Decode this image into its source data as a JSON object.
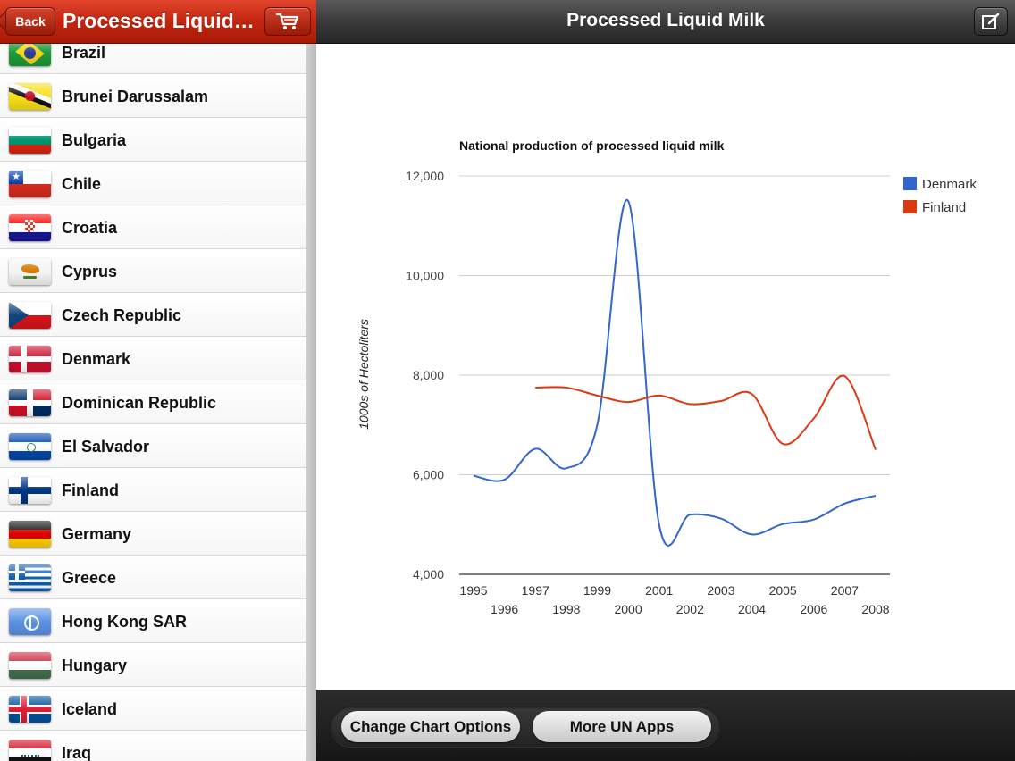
{
  "left_nav": {
    "back_label": "Back",
    "title": "Processed Liquid Milk",
    "cart_icon": "cart-icon"
  },
  "countries": [
    {
      "name": "Brazil",
      "flag": "flag-brazil-icon"
    },
    {
      "name": "Brunei Darussalam",
      "flag": "flag-brunei-icon"
    },
    {
      "name": "Bulgaria",
      "flag": "flag-bulgaria-icon"
    },
    {
      "name": "Chile",
      "flag": "flag-chile-icon"
    },
    {
      "name": "Croatia",
      "flag": "flag-croatia-icon"
    },
    {
      "name": "Cyprus",
      "flag": "flag-cyprus-icon"
    },
    {
      "name": "Czech Republic",
      "flag": "flag-czech-icon"
    },
    {
      "name": "Denmark",
      "flag": "flag-denmark-icon"
    },
    {
      "name": "Dominican Republic",
      "flag": "flag-dominican-icon"
    },
    {
      "name": "El Salvador",
      "flag": "flag-el-salvador-icon"
    },
    {
      "name": "Finland",
      "flag": "flag-finland-icon"
    },
    {
      "name": "Germany",
      "flag": "flag-germany-icon"
    },
    {
      "name": "Greece",
      "flag": "flag-greece-icon"
    },
    {
      "name": "Hong Kong SAR",
      "flag": "flag-un-icon"
    },
    {
      "name": "Hungary",
      "flag": "flag-hungary-icon"
    },
    {
      "name": "Iceland",
      "flag": "flag-iceland-icon"
    },
    {
      "name": "Iraq",
      "flag": "flag-iraq-icon"
    }
  ],
  "right_nav": {
    "title": "Processed Liquid Milk",
    "edit_icon": "compose-icon"
  },
  "bottom_toolbar": {
    "change_chart_label": "Change Chart Options",
    "more_apps_label": "More UN Apps"
  },
  "colors": {
    "denmark": "#3366cc",
    "finland": "#dc3912",
    "nav_red": "#c4250f",
    "nav_dark": "#3a3a3a"
  },
  "chart_data": {
    "type": "line",
    "title": "National production of processed liquid milk",
    "xlabel": "",
    "ylabel": "1000s of Hectoliters",
    "x": [
      1995,
      1996,
      1997,
      1998,
      1999,
      2000,
      2001,
      2002,
      2003,
      2004,
      2005,
      2006,
      2007,
      2008
    ],
    "ylim": [
      4000,
      12000
    ],
    "yticks": [
      "4,000",
      "6,000",
      "8,000",
      "10,000",
      "12,000"
    ],
    "grid": true,
    "legend_position": "right",
    "series": [
      {
        "name": "Denmark",
        "values": [
          5980,
          5900,
          6520,
          6130,
          7000,
          11500,
          5000,
          5200,
          5120,
          4800,
          5010,
          5100,
          5420,
          5580
        ]
      },
      {
        "name": "Finland",
        "values": [
          null,
          null,
          7750,
          7750,
          7590,
          7460,
          7590,
          7420,
          7480,
          7620,
          6620,
          7130,
          7980,
          6500
        ]
      }
    ]
  }
}
